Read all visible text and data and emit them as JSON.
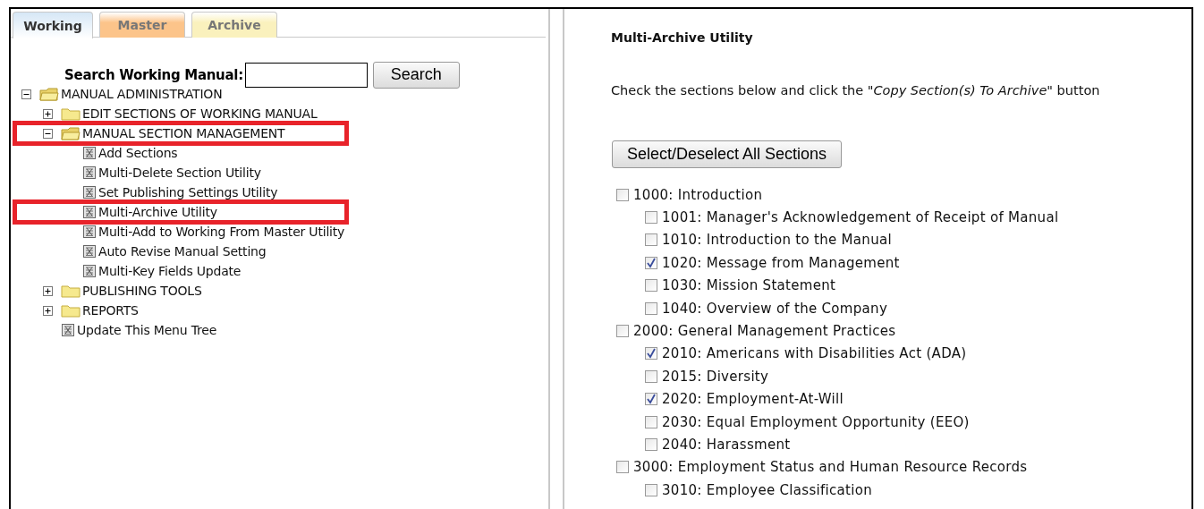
{
  "tabs": [
    {
      "label": "Working",
      "selected": true,
      "color": "#d6e7f6"
    },
    {
      "label": "Master",
      "selected": false,
      "color": "#fcc48a"
    },
    {
      "label": "Archive",
      "selected": false,
      "color": "#faf1bd"
    }
  ],
  "search": {
    "label": "Search Working Manual:",
    "button": "Search"
  },
  "tree": [
    {
      "label": "MANUAL ADMINISTRATION",
      "kind": "folder",
      "expanded": true,
      "highlighted": false,
      "children": [
        {
          "label": "EDIT SECTIONS OF WORKING MANUAL",
          "kind": "folder",
          "expanded": false,
          "highlighted": false
        },
        {
          "label": "MANUAL SECTION MANAGEMENT",
          "kind": "folder",
          "expanded": true,
          "highlighted": true,
          "children": [
            {
              "label": "Add Sections",
              "kind": "page",
              "highlighted": false
            },
            {
              "label": "Multi-Delete Section Utility",
              "kind": "page",
              "highlighted": false
            },
            {
              "label": "Set Publishing Settings Utility",
              "kind": "page",
              "highlighted": false
            },
            {
              "label": "Multi-Archive Utility",
              "kind": "page",
              "highlighted": true
            },
            {
              "label": "Multi-Add to Working From Master Utility",
              "kind": "page",
              "highlighted": false
            },
            {
              "label": "Auto Revise Manual Setting",
              "kind": "page",
              "highlighted": false
            },
            {
              "label": "Multi-Key Fields Update",
              "kind": "page",
              "highlighted": false
            }
          ]
        },
        {
          "label": "PUBLISHING TOOLS",
          "kind": "folder",
          "expanded": false,
          "highlighted": false
        },
        {
          "label": "REPORTS",
          "kind": "folder",
          "expanded": false,
          "highlighted": false
        },
        {
          "label": "Update This Menu Tree",
          "kind": "page",
          "highlighted": false
        }
      ]
    }
  ],
  "content": {
    "title": "Multi-Archive Utility",
    "instruction": "Check the sections below and click the *\"Copy Section(s) To Archive\"* button",
    "select_all_button": "Select/Deselect All Sections",
    "sections": [
      {
        "label": "1000: Introduction",
        "checked": false,
        "children": [
          {
            "label": "1001: Manager's Acknowledgement of Receipt of Manual",
            "checked": false
          },
          {
            "label": "1010: Introduction to the Manual",
            "checked": false
          },
          {
            "label": "1020: Message from Management",
            "checked": true
          },
          {
            "label": "1030: Mission Statement",
            "checked": false
          },
          {
            "label": "1040: Overview of the Company",
            "checked": false
          }
        ]
      },
      {
        "label": "2000: General Management Practices",
        "checked": false,
        "children": [
          {
            "label": "2010: Americans with Disabilities Act (ADA)",
            "checked": true
          },
          {
            "label": "2015: Diversity",
            "checked": false
          },
          {
            "label": "2020: Employment-At-Will",
            "checked": true
          },
          {
            "label": "2030: Equal Employment Opportunity (EEO)",
            "checked": false
          },
          {
            "label": "2040: Harassment",
            "checked": false
          }
        ]
      },
      {
        "label": "3000: Employment Status and Human Resource Records",
        "checked": false,
        "children": [
          {
            "label": "3010: Employee Classification",
            "checked": false
          }
        ]
      }
    ]
  }
}
